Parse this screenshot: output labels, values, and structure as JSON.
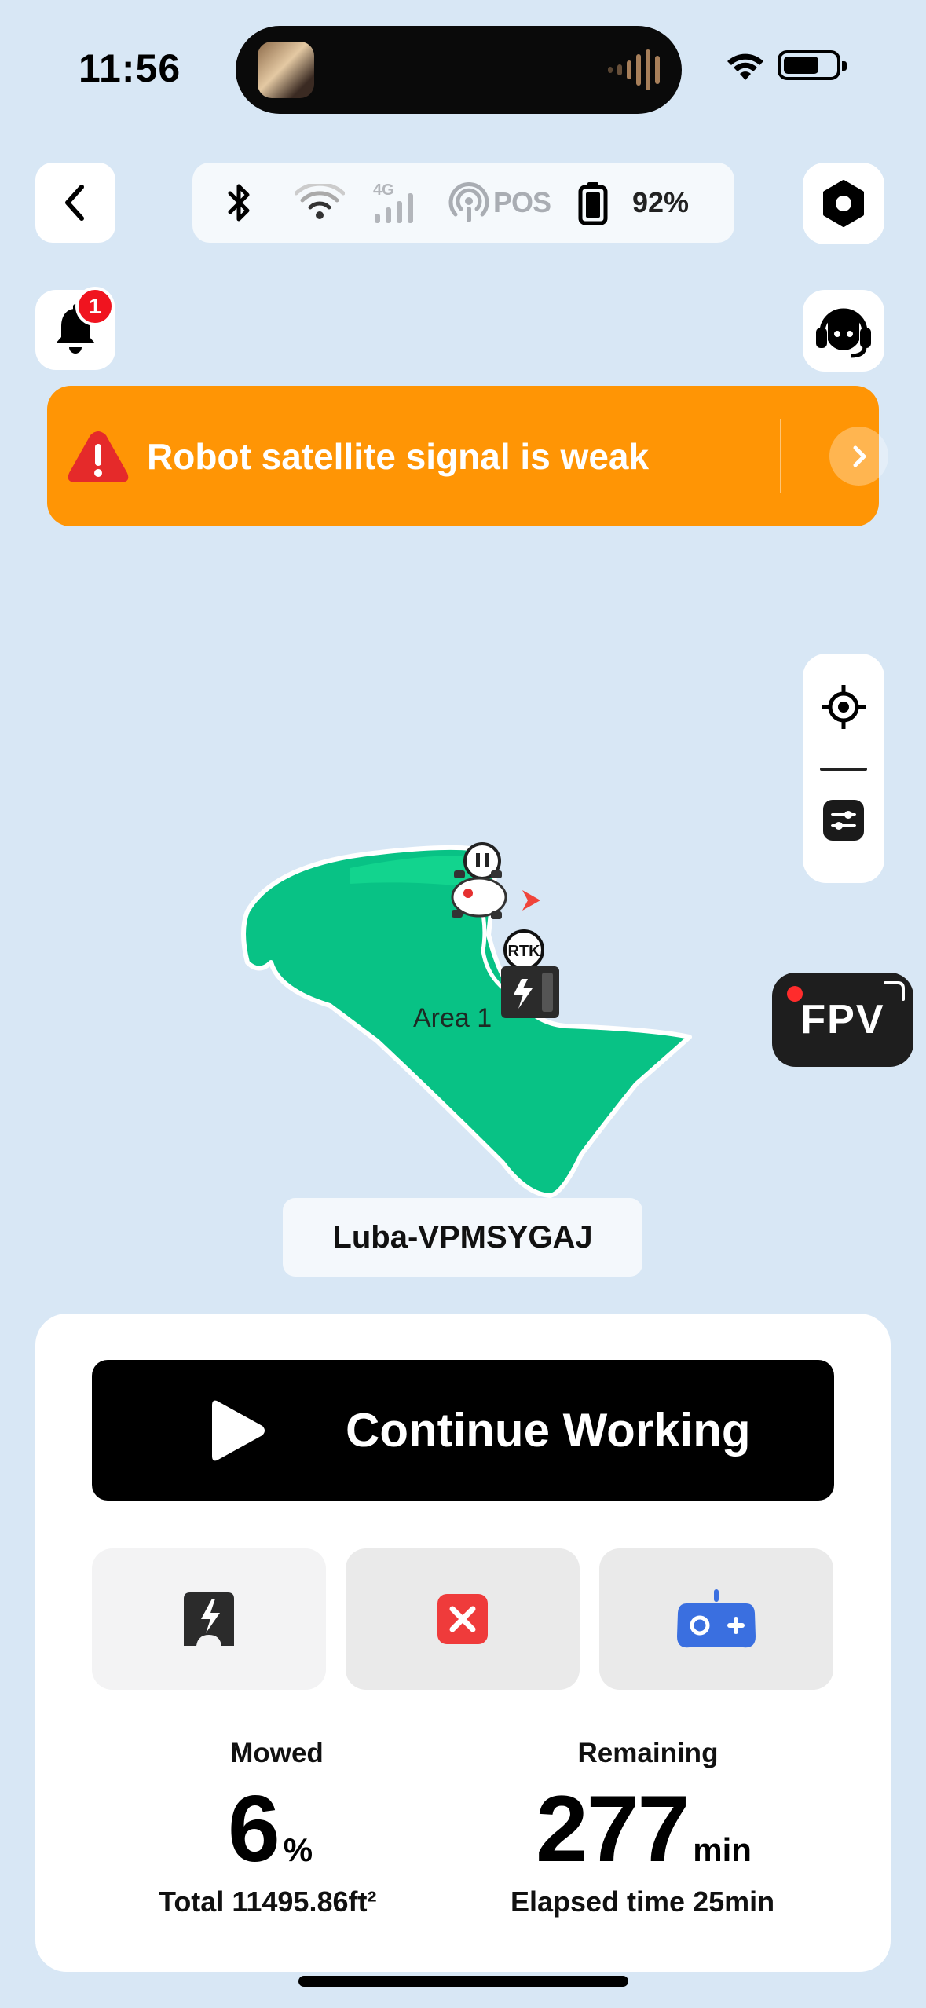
{
  "status_bar": {
    "time": "11:56"
  },
  "top_bar": {
    "connectivity": [
      {
        "icon": "bluetooth-icon",
        "active": true
      },
      {
        "icon": "wifi-icon",
        "active": false
      },
      {
        "icon": "cellular-4g-icon",
        "label": "4G",
        "active": false
      },
      {
        "icon": "rtk-signal-icon",
        "label": "POS",
        "active": false
      }
    ],
    "battery_percent": "92%"
  },
  "notifications": {
    "badge_count": "1"
  },
  "alert": {
    "message": "Robot satellite signal is weak",
    "icon": "warning-icon",
    "color": "#ff9505"
  },
  "map": {
    "area_label": "Area 1",
    "station_label": "RTK",
    "device_name": "Luba-VPMSYGAJ",
    "lawn_color": "#08c285"
  },
  "fpv": {
    "label": "FPV"
  },
  "controls": {
    "primary_label": "Continue Working",
    "actions": [
      {
        "icon": "charge-station-icon"
      },
      {
        "icon": "stop-icon",
        "color": "#ef3b3b"
      },
      {
        "icon": "remote-control-icon",
        "color": "#3a6fe0"
      }
    ]
  },
  "stats": {
    "mowed": {
      "title": "Mowed",
      "value": "6",
      "unit": "%",
      "footer": "Total 11495.86ft²"
    },
    "remaining": {
      "title": "Remaining",
      "value": "277",
      "unit": "min",
      "footer": "Elapsed time 25min"
    }
  }
}
